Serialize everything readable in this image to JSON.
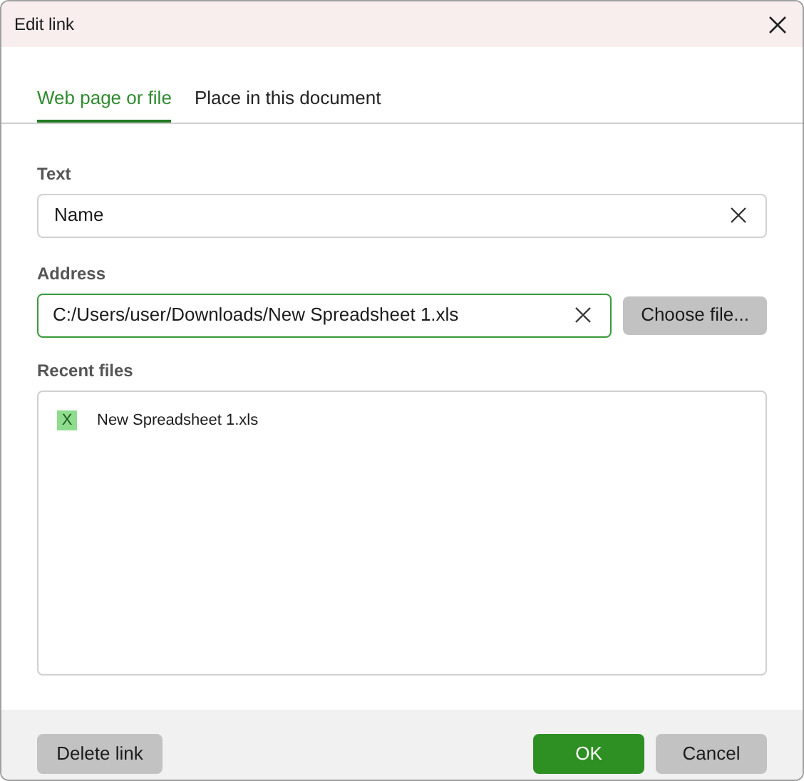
{
  "window": {
    "title": "Edit link"
  },
  "tabs": [
    {
      "label": "Web page or file",
      "selected": true
    },
    {
      "label": "Place in this document",
      "selected": false
    }
  ],
  "text_field": {
    "label": "Text",
    "value": "Name"
  },
  "address_field": {
    "label": "Address",
    "value": "C:/Users/user/Downloads/New Spreadsheet 1.xls",
    "focused": true
  },
  "choose_button": "Choose file...",
  "recent_files": {
    "label": "Recent files",
    "items": [
      {
        "badge": "X",
        "name": "New Spreadsheet 1.xls"
      }
    ]
  },
  "footer": {
    "delete": "Delete link",
    "ok": "OK",
    "cancel": "Cancel"
  }
}
